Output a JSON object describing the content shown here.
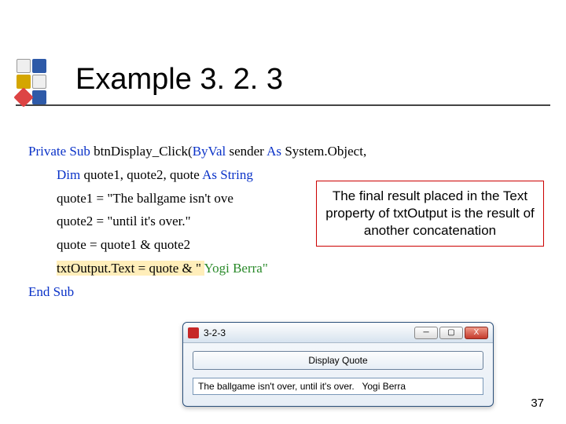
{
  "header": {
    "title": "Example 3. 2. 3"
  },
  "code": {
    "l1a": "Private Sub",
    "l1b": " btnDisplay_Click(",
    "l1c": "ByVal",
    "l1d": " sender ",
    "l1e": "As",
    "l1f": " System.Object,",
    "l2a": "Dim",
    "l2b": " quote1, quote2, quote ",
    "l2c": "As String",
    "l3": "quote1 = \"The ballgame isn't ove",
    "l4": "quote2 = \"until it's over.\"",
    "l5": "quote = quote1 & quote2",
    "l6a": "txtOutput.Text = quote & \" ",
    "l6b": "  Yogi Berra\"",
    "l7": "End Sub"
  },
  "callout": {
    "text": "The final result placed in the Text property of txtOutput is the result of another concatenation"
  },
  "window": {
    "title": "3-2-3",
    "minimize": "─",
    "maximize": "▢",
    "close": "X",
    "button_label": "Display Quote",
    "output_value": "The ballgame isn't over, until it's over.   Yogi Berra"
  },
  "pagenum": "37"
}
